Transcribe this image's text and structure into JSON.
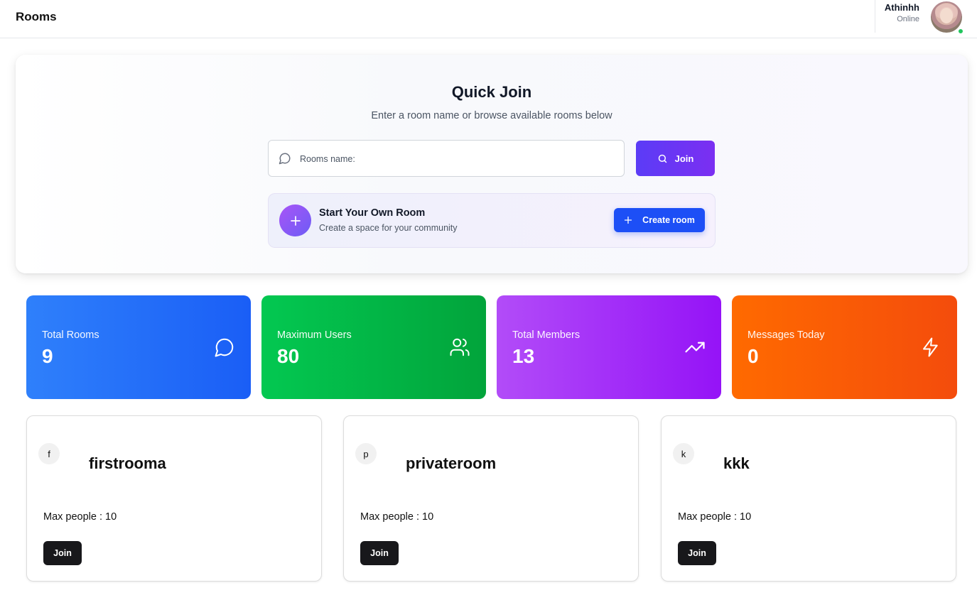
{
  "header": {
    "title": "Rooms",
    "user": {
      "name": "Athinhh",
      "status": "Online"
    }
  },
  "quick_join": {
    "title": "Quick Join",
    "subtitle": "Enter a room name or browse available rooms below",
    "search_placeholder": "Rooms name:",
    "search_value": "",
    "join_label": "Join",
    "create": {
      "title": "Start Your Own Room",
      "subtitle": "Create a space for your community",
      "button_label": "Create room"
    }
  },
  "stats": [
    {
      "label": "Total Rooms",
      "value": "9",
      "icon": "chat-bubble-icon",
      "color": "#2f80fb"
    },
    {
      "label": "Maximum Users",
      "value": "80",
      "icon": "users-icon",
      "color": "#03c851"
    },
    {
      "label": "Total Members",
      "value": "13",
      "icon": "trending-up-icon",
      "color": "#b24cf8"
    },
    {
      "label": "Messages Today",
      "value": "0",
      "icon": "lightning-icon",
      "color": "#ff6a00"
    }
  ],
  "rooms": [
    {
      "initial": "f",
      "name": "firstrooma",
      "max_label": "Max people : 10",
      "join_label": "Join"
    },
    {
      "initial": "p",
      "name": "privateroom",
      "max_label": "Max people : 10",
      "join_label": "Join"
    },
    {
      "initial": "k",
      "name": "kkk",
      "max_label": "Max people : 10",
      "join_label": "Join"
    }
  ]
}
